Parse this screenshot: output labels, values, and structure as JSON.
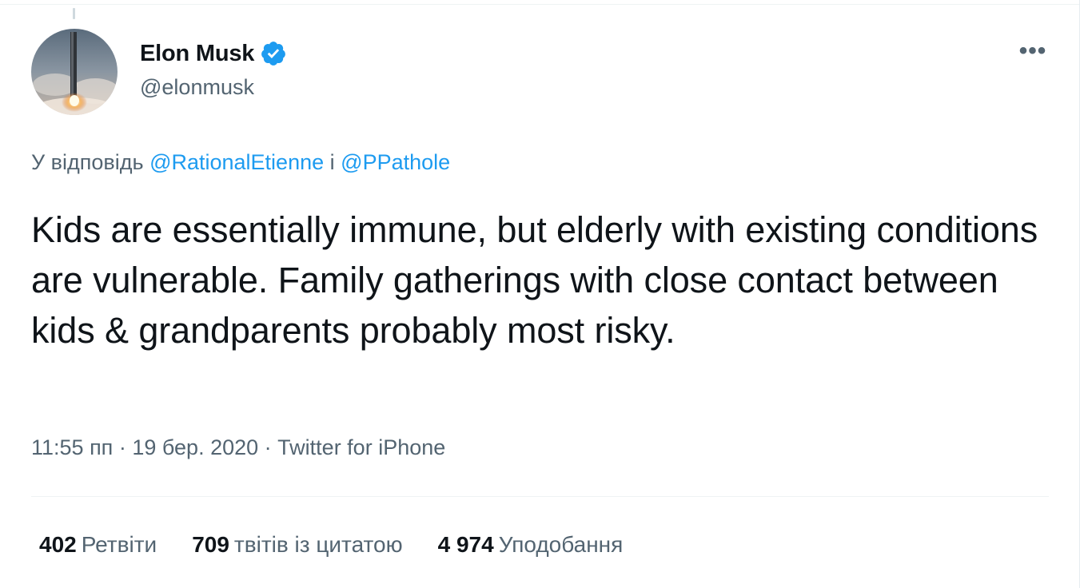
{
  "author": {
    "name": "Elon Musk",
    "handle": "@elonmusk",
    "verified": true,
    "avatar_icon": "rocket-launch-avatar"
  },
  "reply": {
    "prefix": "У відповідь",
    "user1": "@RationalEtienne",
    "conjunction": "і",
    "user2": "@PPathole"
  },
  "tweet": {
    "text": "Kids are essentially immune, but elderly with existing conditions are vulnerable. Family gatherings with close contact between kids & grandparents probably most risky."
  },
  "meta": {
    "time": "11:55 пп",
    "date": "19 бер. 2020",
    "source": "Twitter for iPhone",
    "separator": "·"
  },
  "stats": [
    {
      "count": "402",
      "label": "Ретвіти"
    },
    {
      "count": "709",
      "label": "твітів із цитатою"
    },
    {
      "count": "4 974",
      "label": "Уподобання"
    }
  ],
  "more_label": "•••",
  "colors": {
    "link": "#1d9bf0",
    "secondary_text": "#536471",
    "primary_text": "#0f1419",
    "verified_badge": "#1d9bf0"
  }
}
